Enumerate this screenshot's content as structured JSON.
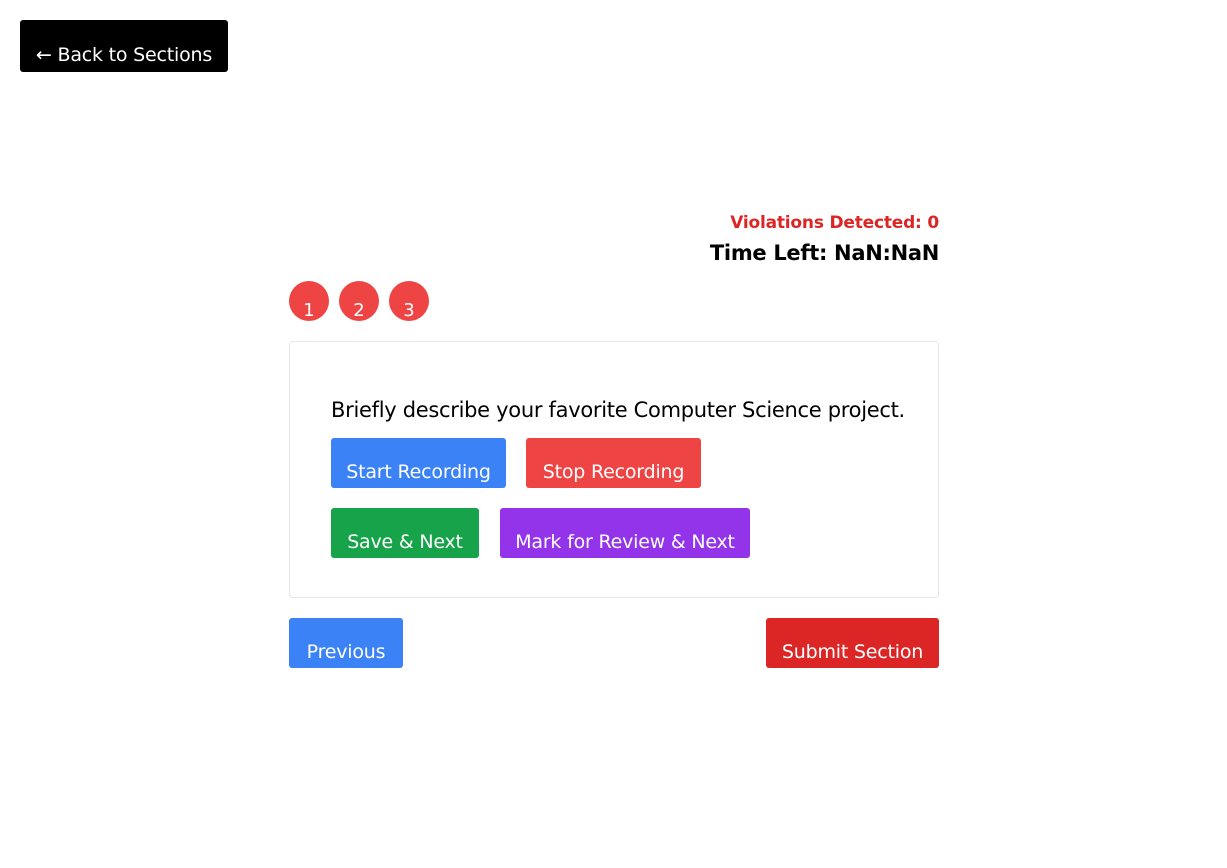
{
  "header": {
    "back_label": "← Back to Sections"
  },
  "status": {
    "violations": "Violations Detected: 0",
    "time_left": "Time Left: NaN:NaN"
  },
  "question_nav": {
    "items": [
      {
        "label": "1"
      },
      {
        "label": "2"
      },
      {
        "label": "3"
      }
    ]
  },
  "question": {
    "text": "Briefly describe your favorite Computer Science project.",
    "start_recording_label": "Start Recording",
    "stop_recording_label": "Stop Recording",
    "save_next_label": "Save & Next",
    "mark_review_label": "Mark for Review & Next"
  },
  "footer": {
    "previous_label": "Previous",
    "submit_label": "Submit Section"
  },
  "colors": {
    "accent_blue": "#3b82f6",
    "danger_red": "#ef4444",
    "submit_red": "#dc2626",
    "save_green": "#16a34a",
    "review_purple": "#9333ea",
    "violation_text": "#dc2626"
  }
}
